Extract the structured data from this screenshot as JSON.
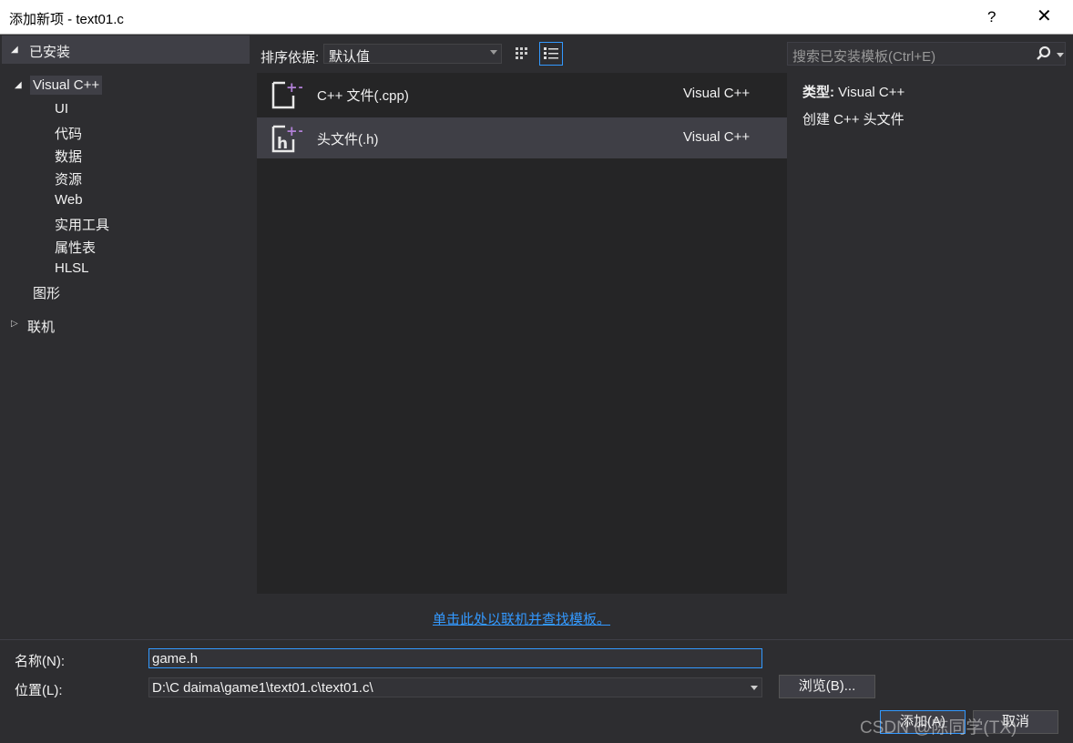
{
  "window": {
    "title": "添加新项 - text01.c",
    "help": "?",
    "close": "✕"
  },
  "left": {
    "header": "已安装",
    "tree": {
      "root": "Visual C++",
      "children": [
        "UI",
        "代码",
        "数据",
        "资源",
        "Web",
        "实用工具",
        "属性表",
        "HLSL"
      ],
      "graphics": "图形",
      "online": "联机"
    }
  },
  "toolbar": {
    "sort_label": "排序依据:",
    "sort_value": "默认值"
  },
  "templates": [
    {
      "name": "C++ 文件(.cpp)",
      "lang": "Visual C++"
    },
    {
      "name": "头文件(.h)",
      "lang": "Visual C++"
    }
  ],
  "online_link": "单击此处以联机并查找模板。",
  "search": {
    "placeholder": "搜索已安装模板(Ctrl+E)"
  },
  "info": {
    "type_label": "类型:",
    "type_value": "Visual C++",
    "description": "创建 C++ 头文件"
  },
  "form": {
    "name_label": "名称(N):",
    "name_value": "game.h",
    "location_label": "位置(L):",
    "location_value": "D:\\C   daima\\game1\\text01.c\\text01.c\\",
    "browse_label": "浏览(B)...",
    "add_label": "添加(A)",
    "cancel_label": "取消"
  },
  "watermark": "CSDN @陈同学(TX)",
  "colors": {
    "accent": "#3399ff",
    "background": "#2d2d30",
    "panel": "#252526",
    "selection": "#3f3f46",
    "plus_badge": "#b180d7"
  }
}
